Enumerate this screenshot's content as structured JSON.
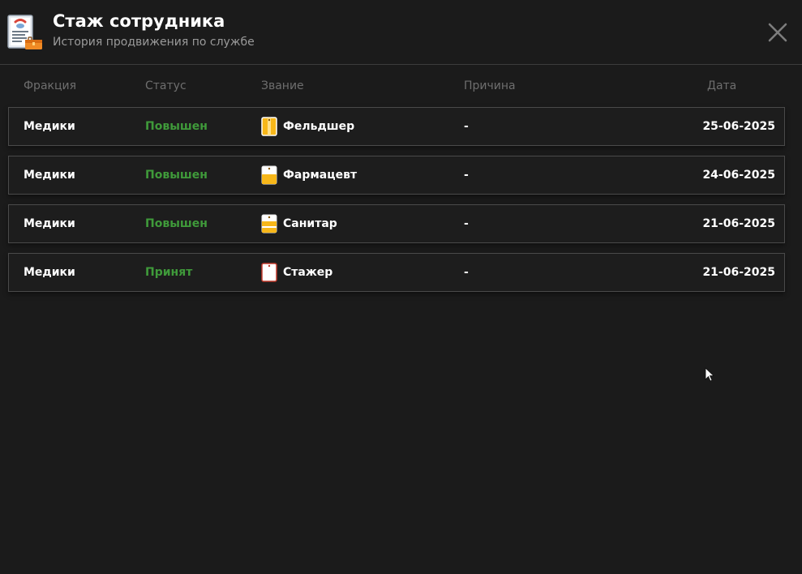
{
  "header": {
    "title": "Стаж сотрудника",
    "subtitle": "История продвижения по службе"
  },
  "columns": {
    "faction": "Фракция",
    "status": "Статус",
    "rank": "Звание",
    "reason": "Причина",
    "date": "Дата"
  },
  "rows": [
    {
      "faction": "Медики",
      "status": "Повышен",
      "rank": "Фельдшер",
      "reason": "-",
      "date": "25-06-2025",
      "badge": "tag-vertical-stripe"
    },
    {
      "faction": "Медики",
      "status": "Повышен",
      "rank": "Фармацевт",
      "reason": "-",
      "date": "24-06-2025",
      "badge": "tag-one-band"
    },
    {
      "faction": "Медики",
      "status": "Повышен",
      "rank": "Санитар",
      "reason": "-",
      "date": "21-06-2025",
      "badge": "tag-two-bands"
    },
    {
      "faction": "Медики",
      "status": "Принят",
      "rank": "Стажер",
      "reason": "-",
      "date": "21-06-2025",
      "badge": "tag-empty"
    }
  ],
  "colors": {
    "background": "#1b1b1b",
    "status_green": "#3f9a3a",
    "badge_yellow": "#f7b719",
    "badge_red": "#c0392b"
  },
  "icons": {
    "app": "employee-record-icon",
    "close": "close-icon"
  }
}
